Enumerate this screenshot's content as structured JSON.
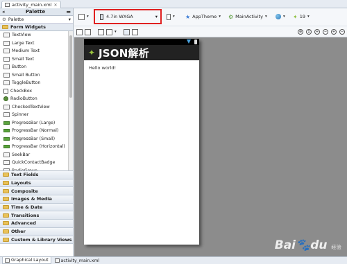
{
  "editor": {
    "file_tab": "activity_main.xml"
  },
  "palette": {
    "title": "Palette",
    "selector": "Palette",
    "open_category": "Form Widgets",
    "widgets": [
      {
        "label": "TextView",
        "icon": "textview-icon"
      },
      {
        "label": "Large Text",
        "icon": "textview-icon"
      },
      {
        "label": "Medium Text",
        "icon": "textview-icon"
      },
      {
        "label": "Small Text",
        "icon": "textview-icon"
      },
      {
        "label": "Button",
        "icon": "button-icon"
      },
      {
        "label": "Small Button",
        "icon": "button-icon"
      },
      {
        "label": "ToggleButton",
        "icon": "button-icon"
      },
      {
        "label": "CheckBox",
        "icon": "checkbox-icon"
      },
      {
        "label": "RadioButton",
        "icon": "radio-icon"
      },
      {
        "label": "CheckedTextView",
        "icon": "textview-icon"
      },
      {
        "label": "Spinner",
        "icon": "spinner-icon"
      },
      {
        "label": "ProgressBar (Large)",
        "icon": "progressbar-icon"
      },
      {
        "label": "ProgressBar (Normal)",
        "icon": "progressbar-icon"
      },
      {
        "label": "ProgressBar (Small)",
        "icon": "progressbar-icon"
      },
      {
        "label": "ProgressBar (Horizontal)",
        "icon": "progressbar-icon"
      },
      {
        "label": "SeekBar",
        "icon": "seekbar-icon"
      },
      {
        "label": "QuickContactBadge",
        "icon": "badge-icon"
      },
      {
        "label": "RadioGroup",
        "icon": "radiogroup-icon"
      }
    ],
    "categories": [
      "Text Fields",
      "Layouts",
      "Composite",
      "Images & Media",
      "Time & Date",
      "Transitions",
      "Advanced",
      "Other",
      "Custom & Library Views"
    ]
  },
  "toolbar": {
    "device": "4.7in WXGA",
    "theme": "AppTheme",
    "activity": "MainActivity",
    "api_level": "19"
  },
  "preview": {
    "app_title": "JSON解析",
    "hello_text": "Hello world!"
  },
  "bottom_tabs": [
    "Graphical Layout",
    "activity_main.xml"
  ],
  "watermark": {
    "brand": "Bai",
    "brand_suffix": "du",
    "sub": "经验"
  }
}
